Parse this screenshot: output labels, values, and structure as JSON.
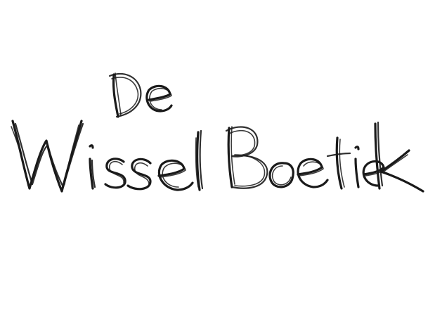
{
  "logo": {
    "line1": "De",
    "line2": "WisselBoetiek",
    "ink_color": "#1a1a1a",
    "background_color": "#ffffff",
    "style": "handwritten scribble lettering"
  }
}
